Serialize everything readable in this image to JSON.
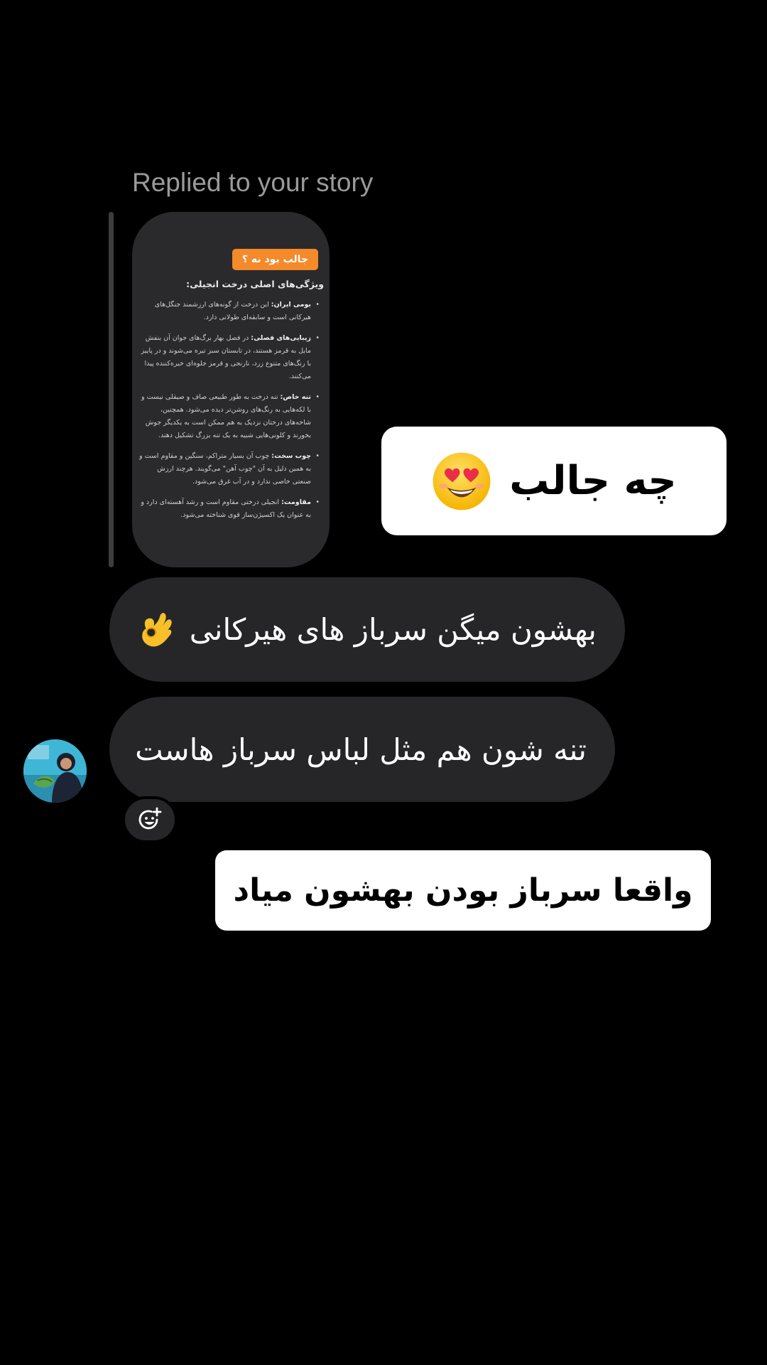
{
  "thread": {
    "reply_caption": "Replied to your story"
  },
  "story": {
    "tag": "جالب بود نه ؟",
    "heading": "ویژگی‌های اصلی درخت انجیلی:",
    "items": [
      {
        "title": "بومی ایران:",
        "text": " این درخت از گونه‌های ارزشمند جنگل‌های هیرکانی است و سابقه‌ای طولانی دارد."
      },
      {
        "title": "زیبایی‌های فصلی:",
        "text": " در فصل بهار برگ‌های جوان آن بنفش مایل به قرمز هستند، در تابستان سبز تیره می‌شوند و در پاییز با رنگ‌های متنوع زرد، نارنجی و قرمز جلوه‌ای خیره‌کننده پیدا می‌کنند."
      },
      {
        "title": "تنه خاص:",
        "text": " تنه درخت به طور طبیعی صاف و صیقلی نیست و با لکه‌هایی به رنگ‌های روشن‌تر دیده می‌شود. همچنین، شاخه‌های درختان نزدیک به هم ممکن است به یکدیگر جوش بخورند و کلونی‌هایی شبیه به یک تنه بزرگ تشکیل دهند."
      },
      {
        "title": "چوب سخت:",
        "text": " چوب آن بسیار متراکم، سنگین و مقاوم است و به همین دلیل به آن \"چوب آهن\" می‌گویند. هرچند ارزش صنعتی خاصی ندارد و در آب غرق می‌شود."
      },
      {
        "title": "مقاومت:",
        "text": " انجیلی درختی مقاوم است و رشد آهسته‌ای دارد و به عنوان یک اکسیژن‌ساز قوی شناخته می‌شود."
      }
    ]
  },
  "messages": {
    "sticker_1": "چه جالب",
    "bubble_1": "بهشون میگن سرباز های هیرکانی",
    "bubble_2": "تنه شون هم مثل لباس سرباز هاست",
    "sticker_2": "واقعا سرباز بودن بهشون میاد"
  },
  "icons": {
    "sticker_1_emoji": "heart-eyes-emoji",
    "bubble_1_emoji": "ok-hand-emoji",
    "react": "add-reaction-icon"
  },
  "colors": {
    "background": "#000000",
    "bubble": "#262628",
    "caption": "#9a9a9a",
    "story_tag": "#f48a2a",
    "card": "#ffffff"
  }
}
